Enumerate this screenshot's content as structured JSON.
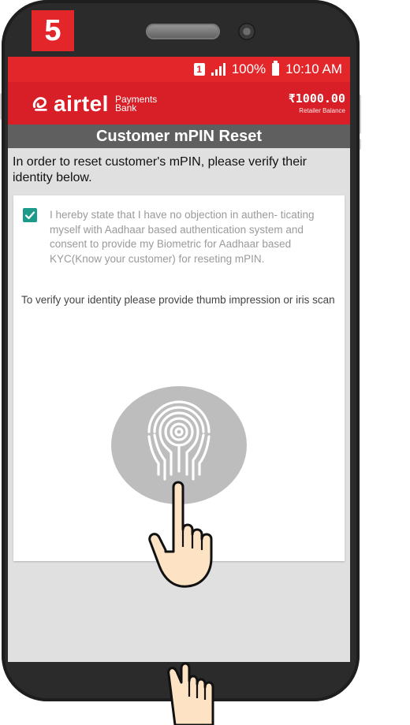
{
  "step": {
    "number": "5"
  },
  "status_bar": {
    "sim": "1",
    "battery": "100%",
    "time": "10:10 AM"
  },
  "app_bar": {
    "brand": "airtel",
    "brand_sub_1": "Payments",
    "brand_sub_2": "Bank",
    "balance": "₹1000.00",
    "balance_label": "Retailer Balance"
  },
  "screen_title": "Customer mPIN Reset",
  "intro_text": "In order to reset customer's mPIN, please verify their identity below.",
  "consent": {
    "checked": true,
    "text": "I hereby state that I have no objection in authen- ticating myself with Aadhaar based authentication system and consent to provide my Biometric for Aadhaar based KYC(Know your customer) for reseting mPIN."
  },
  "verify_text": "To verify your identity please provide thumb impression or iris scan",
  "colors": {
    "brand_red": "#d81f27",
    "status_red": "#e3262a",
    "title_gray": "#5f5f5f",
    "checkbox_teal": "#1c9a8a"
  },
  "icons": [
    "fingerprint-icon",
    "hand-pointer-icon",
    "check-icon",
    "signal-icon",
    "battery-icon",
    "sim-icon"
  ]
}
